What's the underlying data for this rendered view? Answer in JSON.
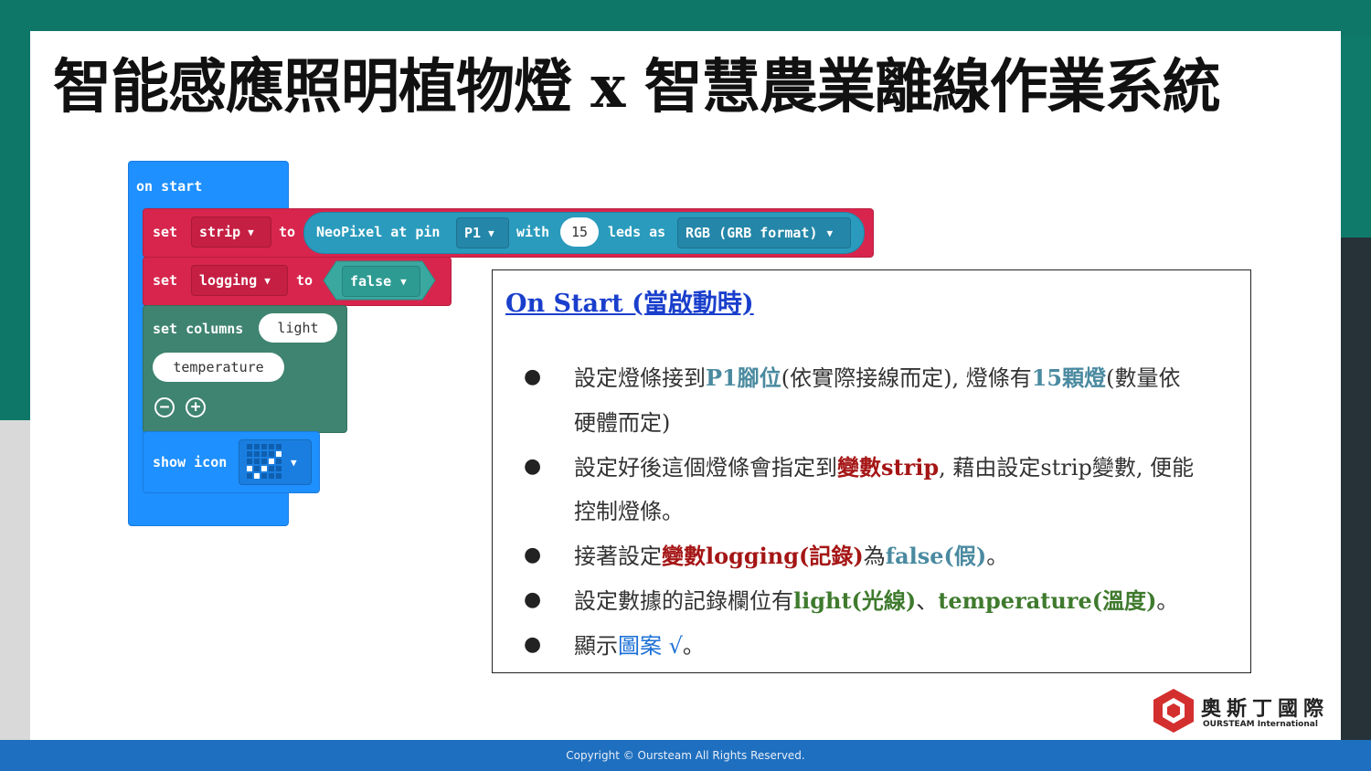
{
  "title": "智能感應照明植物燈 x 智慧農業離線作業系統",
  "blocks": {
    "on_start": "on start",
    "set1": "set",
    "strip": "strip",
    "to1": "to",
    "neopixel": "NeoPixel at pin",
    "pin": "P1",
    "with": "with",
    "leds_count": "15",
    "leds_as": "leds as",
    "format": "RGB (GRB format)",
    "set2": "set",
    "logging": "logging",
    "to2": "to",
    "false_val": "false",
    "set_columns": "set columns",
    "col1": "light",
    "col2": "temperature",
    "minus": "−",
    "plus": "+",
    "show_icon": "show icon",
    "caret": "▼"
  },
  "box": {
    "heading": "On Start (當啟動時)",
    "bullet": "●",
    "b1_a": "設定燈條接到",
    "b1_b": "P1腳位",
    "b1_c": "(依實際接線而定), 燈條有",
    "b1_d": "15顆燈",
    "b1_e": "(數量依",
    "b1_f": "硬體而定)",
    "b2_a": "設定好後這個燈條會指定到",
    "b2_b": "變數strip",
    "b2_c": ", 藉由設定strip變數, 便能",
    "b2_d": "控制燈條。",
    "b3_a": "接著設定",
    "b3_b": "變數logging(記錄)",
    "b3_c": "為",
    "b3_d": "false(假)",
    "b3_e": "。",
    "b4_a": "設定數據的記錄欄位有",
    "b4_b": "light(光線)",
    "b4_c": "、",
    "b4_d": "temperature(溫度)",
    "b4_e": "。",
    "b5_a": "顯示",
    "b5_b": "圖案 √",
    "b5_c": "。"
  },
  "logo": {
    "name": "奧斯丁國際",
    "sub": "OURSTEAM International"
  },
  "footer": "Copyright © Oursteam All Rights Reserved.",
  "colors": {
    "red_block": "#d8254d",
    "blue_block": "#1e90ff",
    "green_block": "#3f8470",
    "footer": "#1e6fbf"
  }
}
